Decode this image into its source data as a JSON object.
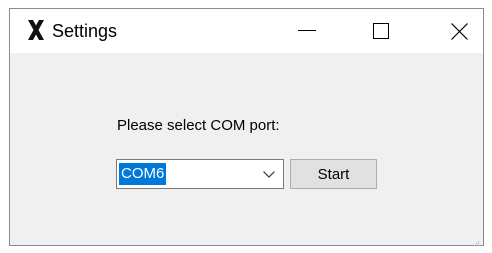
{
  "window": {
    "title": "Settings",
    "icon": "x-logo-icon",
    "controls": [
      "minimize-icon",
      "maximize-icon",
      "close-icon"
    ]
  },
  "main": {
    "prompt": "Please select COM port:",
    "com_select": {
      "value": "COM6",
      "selected_highlight_color": "#0078d7"
    },
    "start_label": "Start"
  }
}
